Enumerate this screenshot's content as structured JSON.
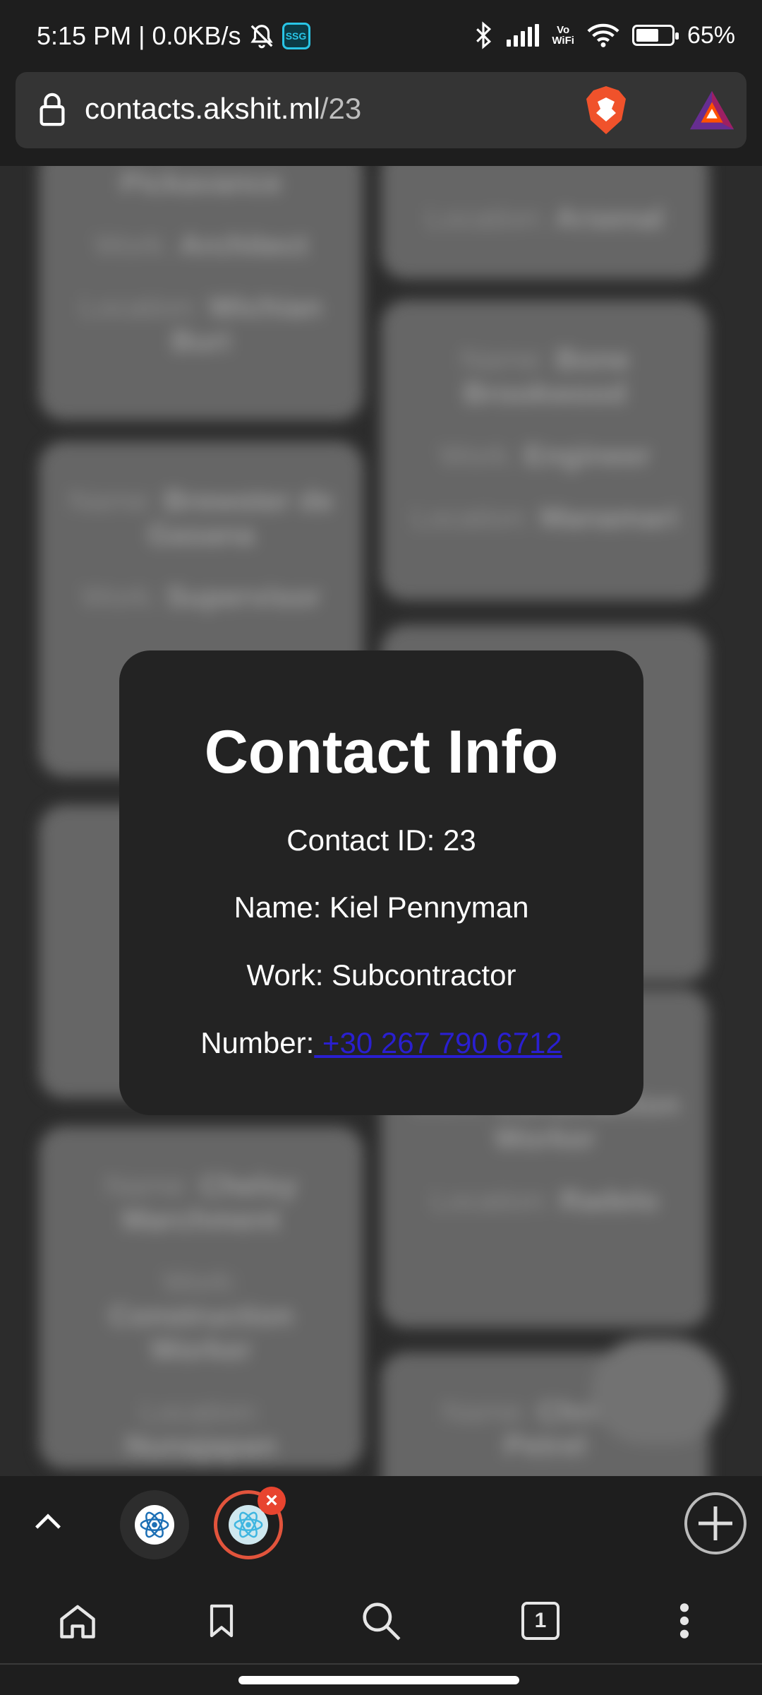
{
  "status_bar": {
    "time": "5:15 PM",
    "network_speed": "0.0KB/s",
    "ssg_badge": "SSG",
    "vowifi_line1": "Vo",
    "vowifi_line2": "WiFi",
    "battery_percent": "65%",
    "battery_level": 0.65,
    "icons": [
      "mute-bell-icon",
      "bluetooth-icon",
      "signal-icon",
      "vowifi-icon",
      "wifi-icon",
      "battery-icon"
    ]
  },
  "address_bar": {
    "domain": "contacts.akshit.ml",
    "path": "/23",
    "icons": [
      "lock-icon",
      "brave-shield-icon",
      "brave-rewards-icon"
    ]
  },
  "background_cards": [
    {
      "name_label": "",
      "name": "Pickavance",
      "work_label": "Work:",
      "work": "Architect",
      "location_label": "Location:",
      "location": "Wichian Buri"
    },
    {
      "location_label": "Location:",
      "location": "Arsenal"
    },
    {
      "name_label": "Name:",
      "name": "Bone Brookwood",
      "work_label": "Work:",
      "work": "Engineer",
      "location_label": "Location:",
      "location": "Manamari"
    },
    {
      "name_label": "Name:",
      "name": "Brewster de Gasana",
      "work_label": "Work:",
      "work": "Supervisor"
    },
    {
      "work_label": "Work:",
      "work": "Construction Worker",
      "location_label": "Location:",
      "location": "Radelo"
    },
    {
      "name_label": "Name:",
      "name": "Chelsy Marchment",
      "work_label": "Work:",
      "work": "Construction Worker",
      "location_label": "Location:",
      "location": "Nunajapan"
    },
    {
      "name_label": "Name:",
      "name": "Christia Petrel"
    }
  ],
  "modal": {
    "title": "Contact Info",
    "contact_id": "Contact ID: 23",
    "name": "Name: Kiel Pennyman",
    "work": "Work: Subcontractor",
    "number_label": "Number:",
    "number": " +30 267 790 6712"
  },
  "tab_strip": {
    "tab_count": "1",
    "accent_color": "#e2543c"
  },
  "colors": {
    "link": "#2a1fd0",
    "modal_bg": "#232323",
    "chrome_bg": "#1e1e1e"
  }
}
